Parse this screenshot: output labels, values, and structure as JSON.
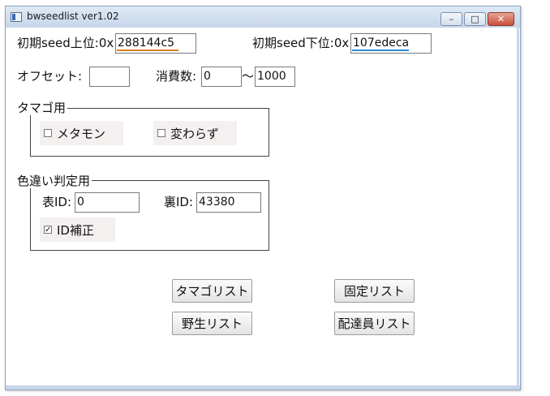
{
  "window": {
    "title": "bwseedlist ver1.02"
  },
  "seed": {
    "upper_label": "初期seed上位:0x",
    "upper_value": "288144c5",
    "lower_label": "初期seed下位:0x",
    "lower_value": "107edeca"
  },
  "offset": {
    "label": "オフセット:",
    "value": ""
  },
  "consume": {
    "label": "消費数:",
    "from": "0",
    "sep": "〜",
    "to": "1000"
  },
  "egg_group": {
    "title": "タマゴ用",
    "ditto": "メタモン",
    "everstone": "変わらず"
  },
  "shiny_group": {
    "title": "色違い判定用",
    "tid_label": "表ID:",
    "tid_value": "0",
    "sid_label": "裏ID:",
    "sid_value": "43380",
    "id_fix": "ID補正"
  },
  "buttons": {
    "egg_list": "タマゴリスト",
    "fixed_list": "固定リスト",
    "wild_list": "野生リスト",
    "delivery_list": "配達員リスト"
  },
  "colors": {
    "upper_underline": "#e07a1a",
    "lower_underline": "#2a8bd8"
  }
}
